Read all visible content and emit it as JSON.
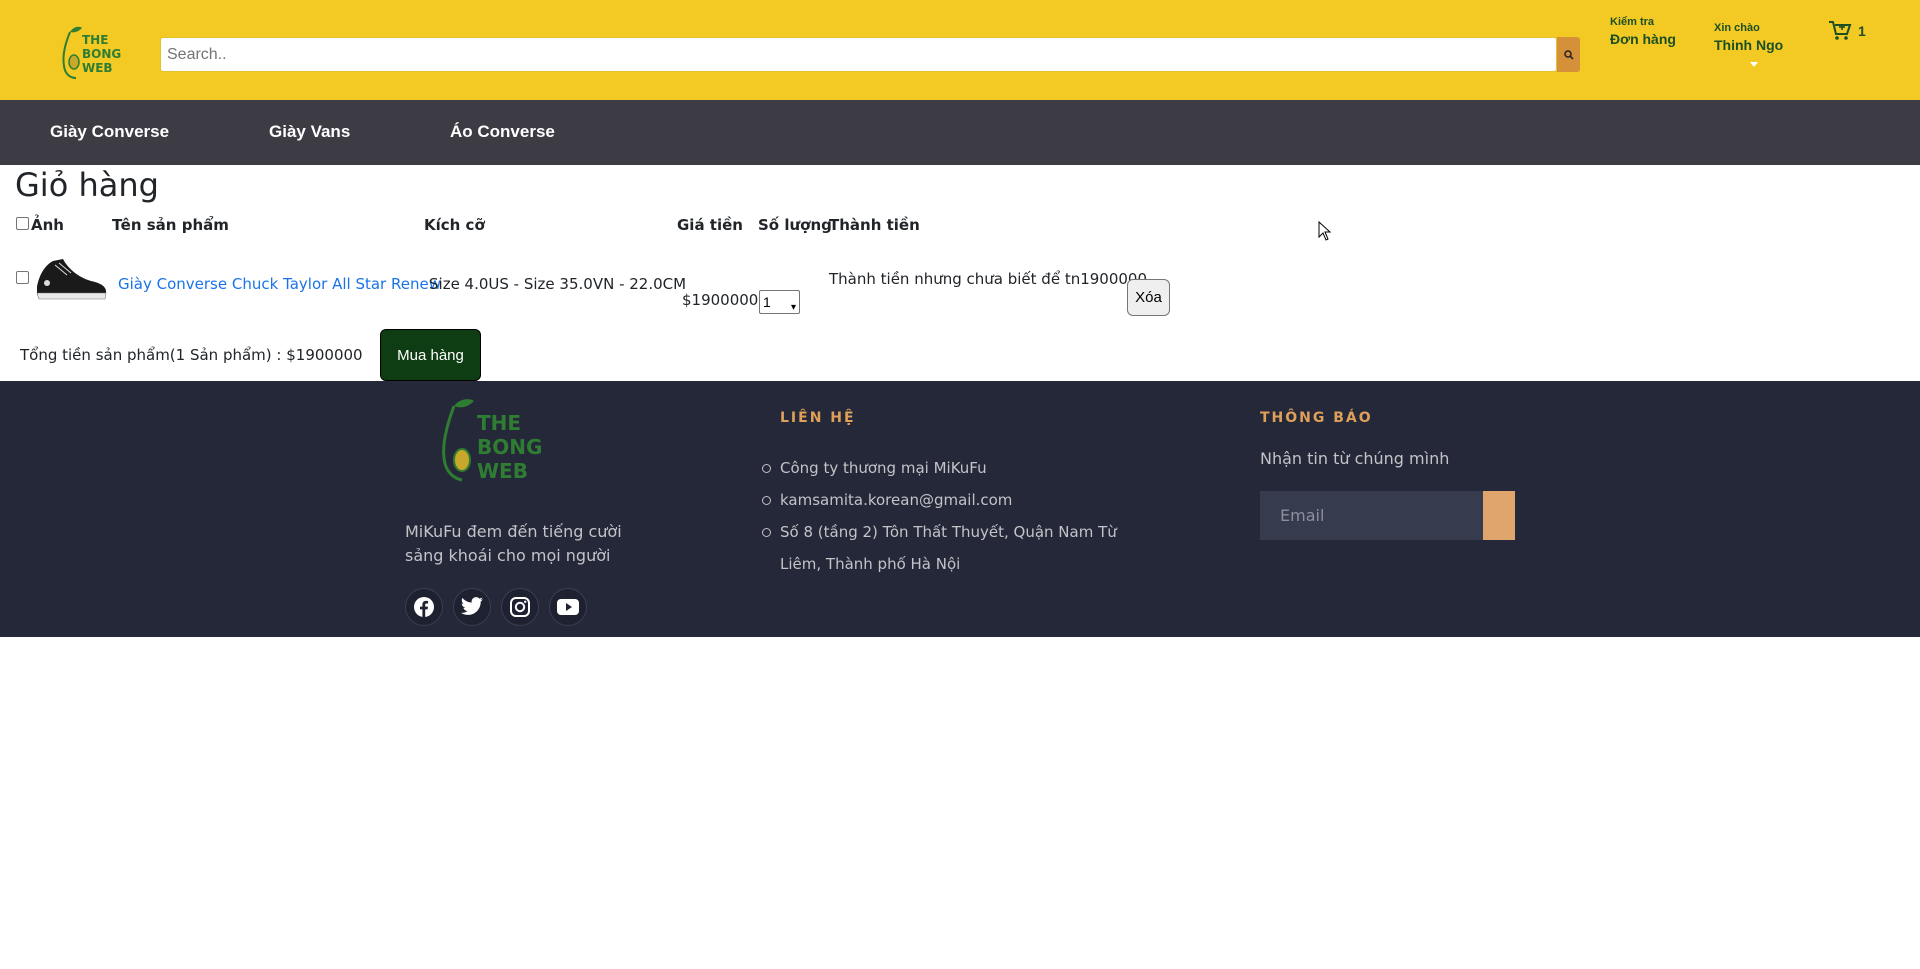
{
  "header": {
    "logo_text": [
      "THE",
      "BONG",
      "WEB"
    ],
    "search_placeholder": "Search..",
    "check_order_small": "Kiểm tra",
    "check_order_big": "Đơn hàng",
    "greeting_small": "Xin chào",
    "greeting_name": "Thinh Ngo",
    "cart_count": "1"
  },
  "nav": {
    "items": [
      "Giày Converse",
      "Giày Vans",
      "Áo Converse"
    ]
  },
  "cart": {
    "title": "Giỏ hàng",
    "columns": {
      "image": "Ảnh",
      "name": "Tên sản phẩm",
      "size": "Kích cỡ",
      "price": "Giá tiền",
      "quantity": "Số lượng",
      "subtotal": "Thành tiền"
    },
    "items": [
      {
        "name": "Giày Converse Chuck Taylor All Star Renew",
        "size": "Size 4.0US - Size 35.0VN - 22.0CM",
        "price": "$1900000",
        "quantity": "1",
        "subtotal": "Thành tiền nhưng chưa biết để tn1900000",
        "delete_label": "Xóa"
      }
    ],
    "total_text": "Tổng tiền sản phẩm(1 Sản phẩm) : $1900000",
    "buy_label": "Mua hàng"
  },
  "footer": {
    "logo_text": [
      "THE",
      "BONG",
      "WEB"
    ],
    "description": "MiKuFu đem đến tiếng cười sảng khoái cho mọi người",
    "contact_heading": "LIÊN HỆ",
    "contact_items": [
      "Công ty thương mại MiKuFu",
      "kamsamita.korean@gmail.com",
      "Số 8 (tầng 2) Tôn Thất Thuyết, Quận Nam Từ Liêm, Thành phố Hà Nội"
    ],
    "notice_heading": "THÔNG BÁO",
    "notice_text": "Nhận tin từ chúng mình",
    "email_placeholder": "Email"
  },
  "colors": {
    "header_bg": "#f3ca24",
    "nav_bg": "#3d3c45",
    "footer_bg": "#242838",
    "accent": "#e0a05a",
    "buy_button": "#0f3d13"
  }
}
